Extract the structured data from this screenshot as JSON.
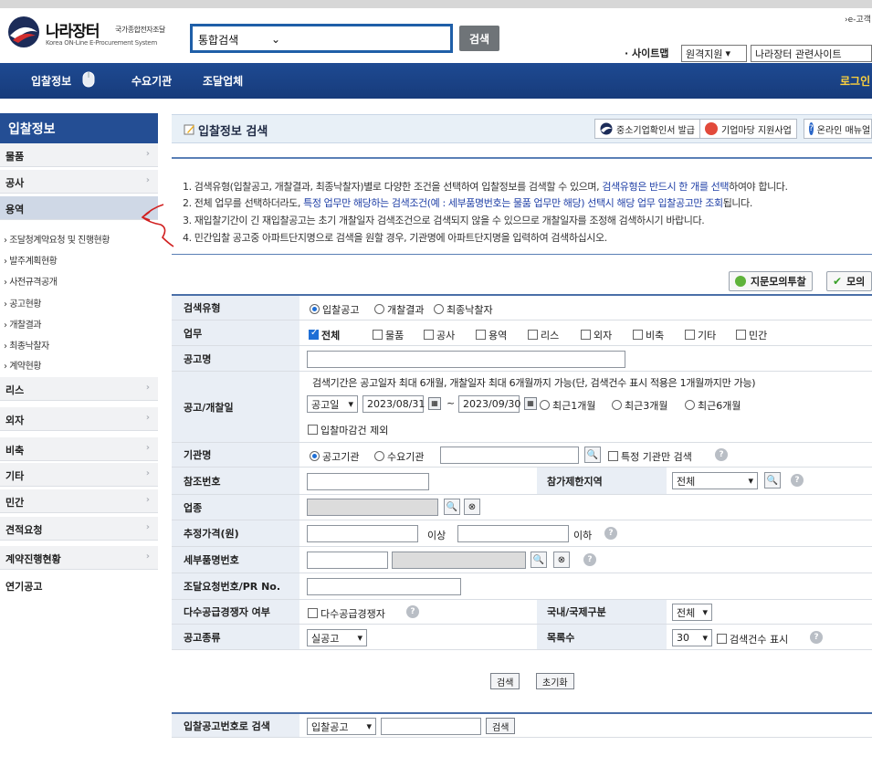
{
  "header": {
    "logo_title": "나라장터",
    "logo_sub_ko": "국가종합전자조달",
    "logo_sub_en": "Korea ON-Line E-Procurement System",
    "search_scope": "통합검색",
    "search_button": "검색",
    "e_label": "›e-고객",
    "sitemap": "· 사이트맵",
    "remote_support": "원격지원",
    "related_sites": "나라장터 관련사이트"
  },
  "nav": {
    "items": [
      "입찰정보",
      "수요기관",
      "조달업체"
    ],
    "login": "로그인"
  },
  "sidebar": {
    "title": "입찰정보",
    "items_top": [
      "물품",
      "공사",
      "용역"
    ],
    "sub_items": [
      "조달청계약요청 및 진행현황",
      "발주계획현황",
      "사전규격공개",
      "공고현황",
      "개찰결과",
      "최종낙찰자",
      "계약현황"
    ],
    "items_bottom": [
      "리스",
      "외자",
      "비축",
      "기타",
      "민간",
      "견적요청",
      "계약진행현황"
    ],
    "plain_item": "연기공고"
  },
  "title_bar": {
    "title": "입찰정보 검색",
    "btn_sme": "중소기업확인서 발급",
    "btn_market": "기업마당 지원사업",
    "btn_manual": "온라인 매뉴얼"
  },
  "notices": {
    "n1_a": "1. 검색유형(입찰공고, 개찰결과, 최종낙찰자)별로 다양한 조건을 선택하여 입찰정보를 검색할 수 있으며, ",
    "n1_b": "검색유형은 반드시 한 개를 선택",
    "n1_c": "하여야 합니다.",
    "n2_a": "2. 전체 업무를 선택하더라도, ",
    "n2_b": "특정 업무만 해당하는 검색조건(예 : 세부품명번호는 물품 업무만 해당) 선택시 해당 업무 입찰공고만 조회",
    "n2_c": "됩니다.",
    "n3": "3. 재입찰기간이 긴 재입찰공고는 초기 개찰일자 검색조건으로 검색되지 않을 수 있으므로 개찰일자를 조정해 검색하시기 바랍니다.",
    "n4": "4. 민간입찰 공고중 아파트단지명으로 검색을 원할 경우, 기관명에 아파트단지명을 입력하여 검색하십시오."
  },
  "actions": {
    "fingerprint": "지문모의투찰",
    "mock": "모의"
  },
  "form": {
    "search_type_label": "검색유형",
    "search_type_options": [
      "입찰공고",
      "개찰결과",
      "최종낙찰자"
    ],
    "task_label": "업무",
    "task_options": [
      "전체",
      "물품",
      "공사",
      "용역",
      "리스",
      "외자",
      "비축",
      "기타",
      "민간"
    ],
    "notice_name_label": "공고명",
    "date_label": "공고/개찰일",
    "date_info": "검색기간은 공고일자 최대 6개월, 개찰일자 최대 6개월까지 가능(단, 검색건수 표시 적용은 1개월까지만 가능)",
    "date_type": "공고일",
    "date_from": "2023/08/31",
    "date_to": "2023/09/30",
    "date_tilde": "~",
    "date_ranges": [
      "최근1개월",
      "최근3개월",
      "최근6개월"
    ],
    "exclude_closed": "입찰마감건 제외",
    "org_label": "기관명",
    "org_options": [
      "공고기관",
      "수요기관"
    ],
    "org_specific": "특정 기관만 검색",
    "ref_label": "참조번호",
    "region_label": "참가제한지역",
    "region_value": "전체",
    "industry_label": "업종",
    "price_label": "추정가격(원)",
    "price_above": "이상",
    "price_below": "이하",
    "item_no_label": "세부품명번호",
    "pr_label": "조달요청번호/PR No.",
    "multi_label": "다수공급경쟁자 여부",
    "multi_option": "다수공급경쟁자",
    "intl_label": "국내/국제구분",
    "intl_value": "전체",
    "kind_label": "공고종류",
    "kind_value": "실공고",
    "list_label": "목록수",
    "list_value": "30",
    "show_count": "검색건수 표시",
    "btn_search": "검색",
    "btn_reset": "초기화"
  },
  "bottom": {
    "label": "입찰공고번호로 검색",
    "select": "입찰공고",
    "button": "검색"
  }
}
